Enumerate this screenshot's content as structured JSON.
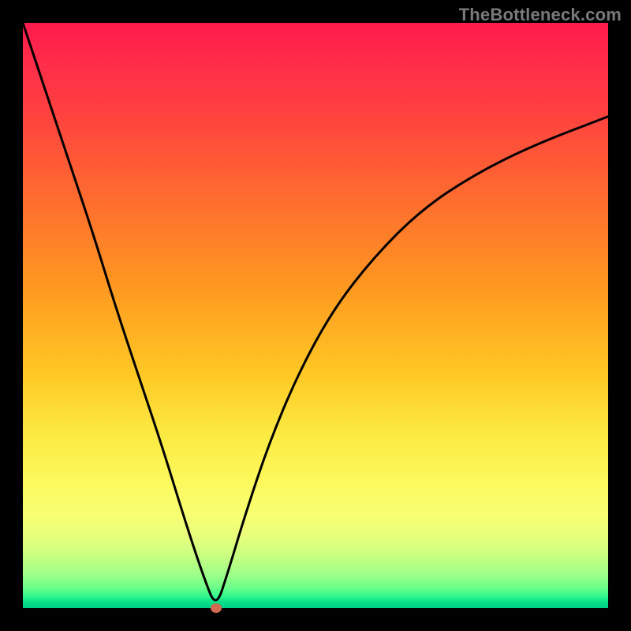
{
  "watermark": "TheBottleneck.com",
  "colors": {
    "background": "#000000",
    "curve": "#000000",
    "marker": "#d26a52",
    "gradient_top": "#ff1a4d",
    "gradient_bottom": "#00d085"
  },
  "chart_data": {
    "type": "line",
    "title": "",
    "xlabel": "",
    "ylabel": "",
    "xlim": [
      0,
      100
    ],
    "ylim": [
      0,
      100
    ],
    "grid": false,
    "curve_description": "V-shaped curve, steep linear descent from top-left to a minimum near x≈33, then asymptotic rise toward the right.",
    "series": [
      {
        "name": "curve",
        "x": [
          0,
          4,
          8,
          12,
          16,
          20,
          24,
          28,
          31,
          33,
          35,
          38,
          42,
          47,
          53,
          60,
          68,
          77,
          87,
          100
        ],
        "y": [
          100,
          88,
          76,
          64,
          51,
          39,
          27,
          14,
          5,
          0,
          6,
          16,
          28,
          40,
          51,
          60,
          68,
          74,
          79,
          84
        ]
      }
    ],
    "marker": {
      "x": 33,
      "y": 0
    },
    "annotations": []
  }
}
